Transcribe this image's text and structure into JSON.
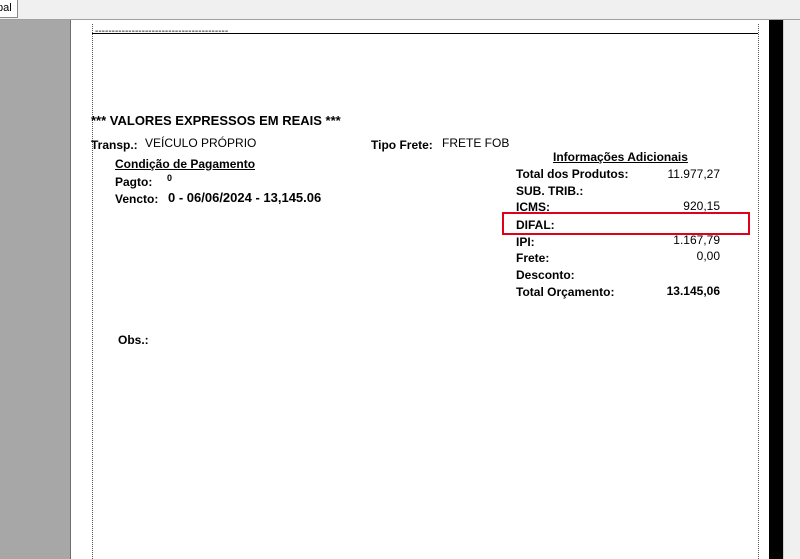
{
  "toolbar": {
    "tab_label": "pal"
  },
  "document": {
    "dash_line": "----------------------------------------",
    "heading": "*** VALORES EXPRESSOS EM REAIS ***",
    "transp_label": "Transp.:",
    "transp_value": "VEÍCULO PRÓPRIO",
    "tipo_frete_label": "Tipo Frete:",
    "tipo_frete_value": "FRETE FOB",
    "payment_title": "Condição de Pagamento",
    "pagto_label": "Pagto:",
    "pagto_value": "0",
    "vencto_label": "Vencto:",
    "vencto_value": "0 - 06/06/2024 - 13,145.06",
    "obs_label": "Obs.:"
  },
  "info": {
    "title": "Informações Adicionais",
    "rows": [
      {
        "label": "Total dos Produtos:",
        "value": "11.977,27"
      },
      {
        "label": "SUB. TRIB.:",
        "value": ""
      },
      {
        "label": "ICMS:",
        "value": "920,15"
      },
      {
        "label": "DIFAL:",
        "value": ""
      },
      {
        "label": "IPI:",
        "value": "1.167,79"
      },
      {
        "label": "Frete:",
        "value": "0,00"
      },
      {
        "label": "Desconto:",
        "value": ""
      },
      {
        "label": "Total Orçamento:",
        "value": "13.145,06"
      }
    ]
  },
  "colors": {
    "highlight": "#e0001b",
    "workspace": "#a6a6a6",
    "page": "#ffffff"
  }
}
